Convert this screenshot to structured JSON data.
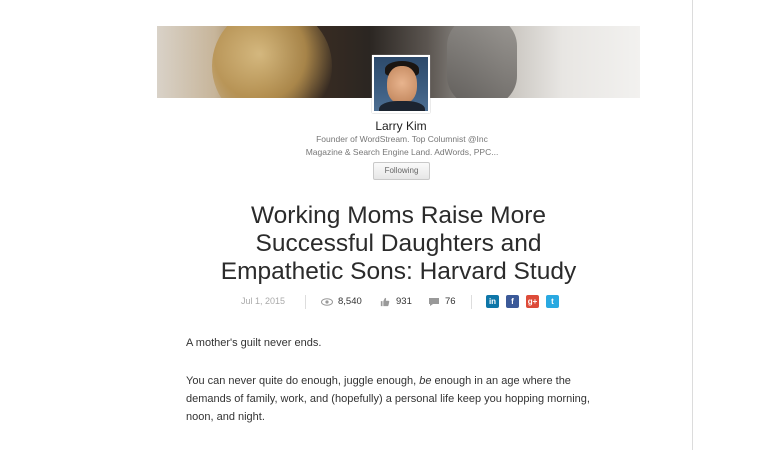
{
  "author": {
    "name": "Larry Kim",
    "bio_line1": "Founder of WordStream. Top Columnist @Inc",
    "bio_line2": "Magazine & Search Engine Land. AdWords, PPC...",
    "follow_label": "Following"
  },
  "article": {
    "title_line1": "Working Moms Raise More",
    "title_line2": "Successful Daughters and",
    "title_line3": "Empathetic Sons: Harvard Study",
    "date": "Jul 1, 2015",
    "views": "8,540",
    "likes": "931",
    "comments": "76",
    "para1": "A mother's guilt never ends.",
    "para2_a": "You can never quite do enough, juggle enough, ",
    "para2_em": "be",
    "para2_b": " enough in an age where the",
    "para2_line2": "demands of family, work, and (hopefully) a personal life keep you hopping morning,",
    "para2_line3": "noon, and night."
  },
  "share": {
    "linkedin": "in",
    "facebook": "f",
    "googleplus": "g+",
    "twitter": "t"
  },
  "icons": {
    "views": "eye-icon",
    "likes": "thumbs-up-icon",
    "comments": "comment-icon"
  },
  "colors": {
    "linkedin": "#0e76a8",
    "facebook": "#3b5998",
    "googleplus": "#dd4b39",
    "twitter": "#29a9e1"
  }
}
